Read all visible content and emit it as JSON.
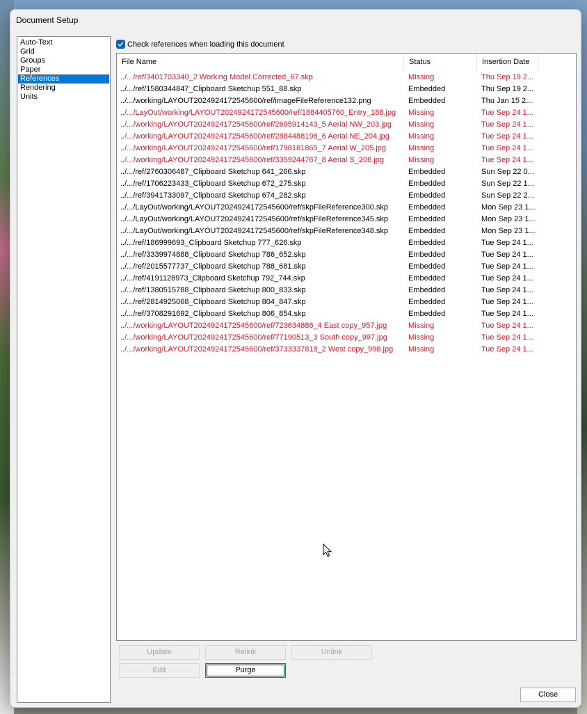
{
  "window": {
    "title": "Document Setup"
  },
  "sidebar": {
    "items": [
      {
        "label": "Auto-Text",
        "selected": false
      },
      {
        "label": "Grid",
        "selected": false
      },
      {
        "label": "Groups",
        "selected": false
      },
      {
        "label": "Paper",
        "selected": false
      },
      {
        "label": "References",
        "selected": true
      },
      {
        "label": "Rendering",
        "selected": false
      },
      {
        "label": "Units",
        "selected": false
      }
    ]
  },
  "references": {
    "check_label": "Check references when loading this document",
    "checked": true,
    "columns": [
      "File Name",
      "Status",
      "Insertion Date"
    ],
    "rows": [
      {
        "file": "../.../ref/3401703340_2 Working Model Corrected_67.skp",
        "status": "Missing",
        "date": "Thu Sep 19 2..."
      },
      {
        "file": "../.../ref/1580344847_Clipboard Sketchup 551_88.skp",
        "status": "Embedded",
        "date": "Thu Sep 19 2..."
      },
      {
        "file": "../.../working/LAYOUT2024924172545600/ref/imageFileReference132.png",
        "status": "Embedded",
        "date": "Thu Jan 15 2..."
      },
      {
        "file": "../.../LayOut/working/LAYOUT2024924172545600/ref/1884405760_Entry_188.jpg",
        "status": "Missing",
        "date": "Tue Sep 24 1..."
      },
      {
        "file": "../.../working/LAYOUT2024924172545600/ref/2695914143_5 Aerial NW_203.jpg",
        "status": "Missing",
        "date": "Tue Sep 24 1..."
      },
      {
        "file": "../.../working/LAYOUT2024924172545600/ref/2884488196_6 Aerial NE_204.jpg",
        "status": "Missing",
        "date": "Tue Sep 24 1..."
      },
      {
        "file": "../.../working/LAYOUT2024924172545600/ref/1798181865_7 Aerial W_205.jpg",
        "status": "Missing",
        "date": "Tue Sep 24 1..."
      },
      {
        "file": "../.../working/LAYOUT2024924172545600/ref/3359244767_8 Aerial S_206.jpg",
        "status": "Missing",
        "date": "Tue Sep 24 1..."
      },
      {
        "file": "../.../ref/2760306487_Clipboard Sketchup 641_266.skp",
        "status": "Embedded",
        "date": "Sun Sep 22 0..."
      },
      {
        "file": "../.../ref/1706223433_Clipboard Sketchup 672_275.skp",
        "status": "Embedded",
        "date": "Sun Sep 22 1..."
      },
      {
        "file": "../.../ref/3941733097_Clipboard Sketchup 674_282.skp",
        "status": "Embedded",
        "date": "Sun Sep 22 2..."
      },
      {
        "file": "../.../LayOut/working/LAYOUT2024924172545600/ref/skpFileReference300.skp",
        "status": "Embedded",
        "date": "Mon Sep 23 1..."
      },
      {
        "file": "../.../LayOut/working/LAYOUT2024924172545600/ref/skpFileReference345.skp",
        "status": "Embedded",
        "date": "Mon Sep 23 1..."
      },
      {
        "file": "../.../LayOut/working/LAYOUT2024924172545600/ref/skpFileReference348.skp",
        "status": "Embedded",
        "date": "Mon Sep 23 1..."
      },
      {
        "file": "../.../ref/186999693_Clipboard Sketchup 777_626.skp",
        "status": "Embedded",
        "date": "Tue Sep 24 1..."
      },
      {
        "file": "../.../ref/3339974888_Clipboard Sketchup 786_652.skp",
        "status": "Embedded",
        "date": "Tue Sep 24 1..."
      },
      {
        "file": "../.../ref/2015577737_Clipboard Sketchup 788_681.skp",
        "status": "Embedded",
        "date": "Tue Sep 24 1..."
      },
      {
        "file": "../.../ref/4191128973_Clipboard Sketchup 792_744.skp",
        "status": "Embedded",
        "date": "Tue Sep 24 1..."
      },
      {
        "file": "../.../ref/1380515788_Clipboard Sketchup 800_833.skp",
        "status": "Embedded",
        "date": "Tue Sep 24 1..."
      },
      {
        "file": "../.../ref/2814925068_Clipboard Sketchup 804_847.skp",
        "status": "Embedded",
        "date": "Tue Sep 24 1..."
      },
      {
        "file": "../.../ref/3708291692_Clipboard Sketchup 806_854.skp",
        "status": "Embedded",
        "date": "Tue Sep 24 1..."
      },
      {
        "file": "../.../working/LAYOUT2024924172545600/ref/723634886_4 East copy_957.jpg",
        "status": "Missing",
        "date": "Tue Sep 24 1..."
      },
      {
        "file": "../.../working/LAYOUT2024924172545600/ref/77190513_3 South copy_997.jpg",
        "status": "Missing",
        "date": "Tue Sep 24 1..."
      },
      {
        "file": "../.../working/LAYOUT2024924172545600/ref/3733337818_2 West copy_998.jpg",
        "status": "Missing",
        "date": "Tue Sep 24 1..."
      }
    ]
  },
  "buttons": {
    "update": {
      "label": "Update",
      "enabled": false
    },
    "relink": {
      "label": "Relink",
      "enabled": false
    },
    "unlink": {
      "label": "Unlink",
      "enabled": false
    },
    "edit": {
      "label": "Edit",
      "enabled": false
    },
    "purge": {
      "label": "Purge",
      "enabled": true
    },
    "close": {
      "label": "Close",
      "enabled": true
    }
  },
  "colors": {
    "missing": "#e81123",
    "selection": "#0078d7",
    "checkbox": "#0067c0"
  },
  "icons": {
    "checkbox": "checkmark-icon",
    "cursor": "mouse-pointer-icon"
  }
}
